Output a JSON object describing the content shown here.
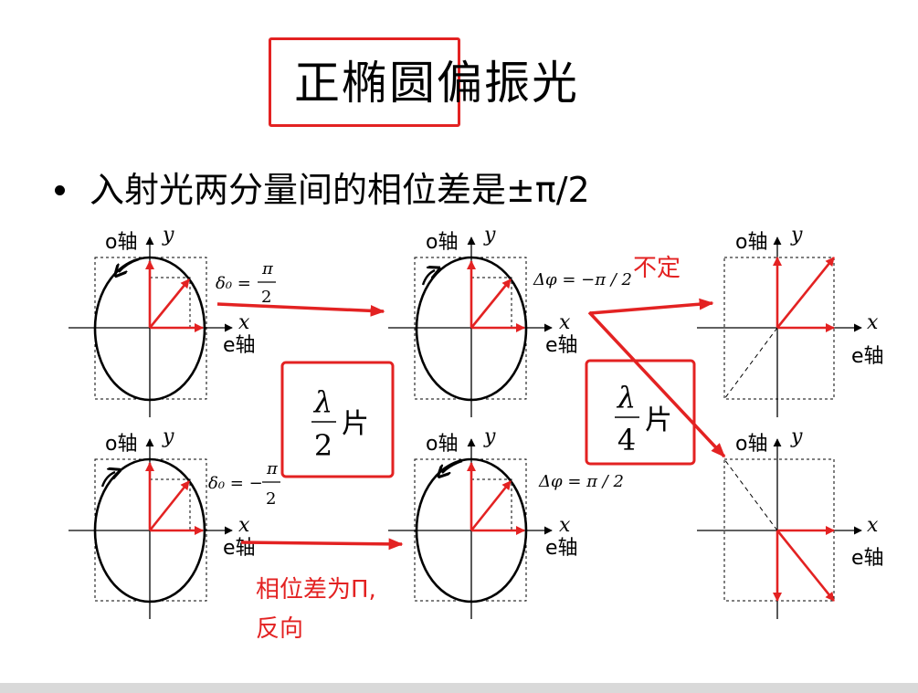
{
  "title": {
    "text": "正椭圆偏振光"
  },
  "bullet": {
    "text": "入射光两分量间的相位差是±π/2"
  },
  "axes": {
    "o_axis": "o轴",
    "e_axis": "e轴",
    "y": "y",
    "x": "x"
  },
  "formulas": {
    "delta_top": {
      "prefix": "δ₀ =",
      "num": "π",
      "den": "2"
    },
    "delta_bottom": {
      "prefix": "δ₀ = −",
      "num": "π",
      "den": "2"
    },
    "dphi_top": "Δφ = −π / 2",
    "dphi_bottom": "Δφ = π / 2"
  },
  "plates": {
    "half": {
      "num": "λ",
      "den": "2",
      "suffix": "片"
    },
    "quarter": {
      "num": "λ",
      "den": "4",
      "suffix": "片"
    }
  },
  "annotations": {
    "uncertain": "不定",
    "phase_note_line1": "相位差为Π,",
    "phase_note_line2": "反向"
  },
  "colors": {
    "accent": "#e32222",
    "ink": "#000000"
  }
}
